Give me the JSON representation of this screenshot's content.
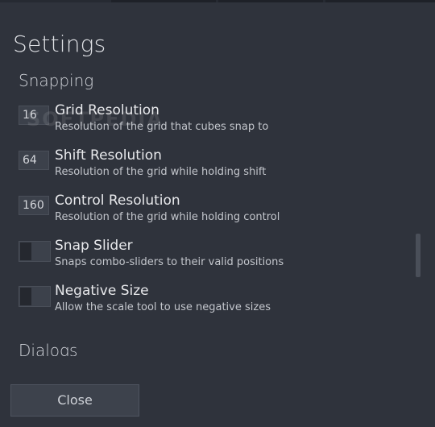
{
  "dialog": {
    "title": "Settings",
    "close_label": "Close"
  },
  "snapping": {
    "section_title": "Snapping",
    "grid_resolution": {
      "value": "16",
      "label": "Grid Resolution",
      "description": "Resolution of the grid that cubes snap to"
    },
    "shift_resolution": {
      "value": "64",
      "label": "Shift Resolution",
      "description": "Resolution of the grid while holding shift"
    },
    "control_resolution": {
      "value": "160",
      "label": "Control Resolution",
      "description": "Resolution of the grid while holding control"
    },
    "snap_slider": {
      "label": "Snap Slider",
      "description": "Snaps combo-sliders to their valid positions",
      "enabled": false
    },
    "negative_size": {
      "label": "Negative Size",
      "description": "Allow the scale tool to use negative sizes",
      "enabled": false
    }
  },
  "dialogs": {
    "section_title": "Dialogs"
  },
  "watermark": {
    "text": "SOFTPEDIA"
  }
}
